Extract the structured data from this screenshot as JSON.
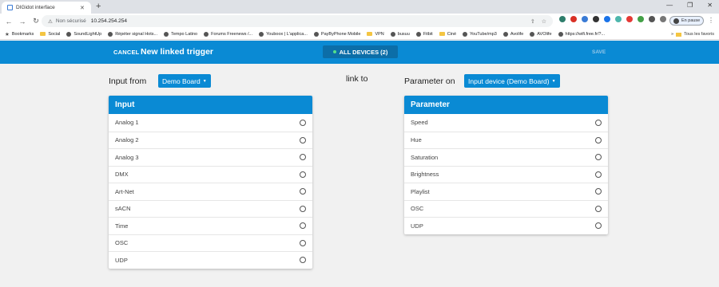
{
  "browser": {
    "tab_title": "DIGidot interface",
    "tab_close": "✕",
    "new_tab": "+",
    "win_minimize": "—",
    "win_restore": "❐",
    "win_close": "✕",
    "insecure_label": "Non sécurisé",
    "url": "10.254.254.254",
    "profile_label": "En pause",
    "bookmarks": [
      {
        "label": "Bookmarks",
        "icon": "star-icon"
      },
      {
        "label": "Social",
        "icon": "folder-icon"
      },
      {
        "label": "SoundLightUp",
        "icon": "site-icon"
      },
      {
        "label": "Répéter signal Hots...",
        "icon": "site-icon"
      },
      {
        "label": "Tempo Latino",
        "icon": "site-icon"
      },
      {
        "label": "Forums Freenews /...",
        "icon": "site-icon"
      },
      {
        "label": "Youboox | L'applica...",
        "icon": "site-icon"
      },
      {
        "label": "PayByPhone Mobile",
        "icon": "site-icon"
      },
      {
        "label": "VPN",
        "icon": "folder-icon"
      },
      {
        "label": "busuu",
        "icon": "site-icon"
      },
      {
        "label": "Fitbit",
        "icon": "site-icon"
      },
      {
        "label": "Ciné",
        "icon": "folder-icon"
      },
      {
        "label": "YouTube/mp3",
        "icon": "site-icon"
      },
      {
        "label": "Avolife",
        "icon": "site-icon"
      },
      {
        "label": "AVOlife",
        "icon": "site-icon"
      },
      {
        "label": "https://wifi.free.fr/?...",
        "icon": "site-icon"
      }
    ],
    "all_bookmarks": "Tous les favoris",
    "bookmarks_more": "»"
  },
  "appbar": {
    "cancel_label": "CANCEL",
    "title": "New linked trigger",
    "devices_label": "ALL DEVICES (2)",
    "save_label": "SAVE"
  },
  "input_section": {
    "label": "Input from",
    "dropdown_value": "Demo Board",
    "panel_title": "Input",
    "items": [
      "Analog 1",
      "Analog 2",
      "Analog 3",
      "DMX",
      "Art-Net",
      "sACN",
      "Time",
      "OSC",
      "UDP"
    ]
  },
  "link_label": "link to",
  "parameter_section": {
    "label": "Parameter on",
    "dropdown_value": "Input device (Demo Board)",
    "panel_title": "Parameter",
    "items": [
      "Speed",
      "Hue",
      "Saturation",
      "Brightness",
      "Playlist",
      "OSC",
      "UDP"
    ]
  },
  "colors": {
    "accent": "#0a8ad4",
    "devices_bg": "#0c6ea8",
    "status_dot": "#53e08a",
    "background": "#f1f1f1"
  }
}
